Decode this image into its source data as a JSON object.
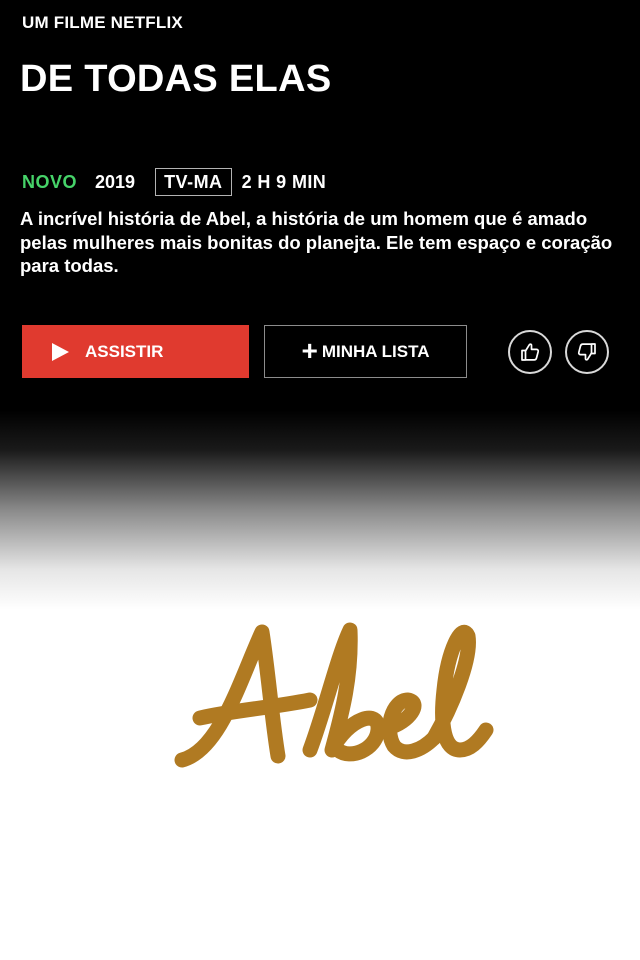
{
  "header": {
    "label": "UM FILME NETFLIX",
    "title": "DE TODAS ELAS"
  },
  "meta": {
    "badge_new": "NOVO",
    "year": "2019",
    "rating": "TV-MA",
    "duration": "2 H 9 MIN"
  },
  "synopsis": "A incrível história de Abel, a história de um homem que é amado pelas mulheres mais bonitas do planejta. Ele tem espaço e coração para todas.",
  "actions": {
    "play_label": "ASSISTIR",
    "my_list_label": "MINHA LISTA",
    "like_icon": "thumbs-up-icon",
    "dislike_icon": "thumbs-down-icon"
  },
  "logo": {
    "text": "Abel",
    "color": "#b07a22"
  },
  "colors": {
    "accent_red": "#e03a2f",
    "new_green": "#46d369"
  }
}
